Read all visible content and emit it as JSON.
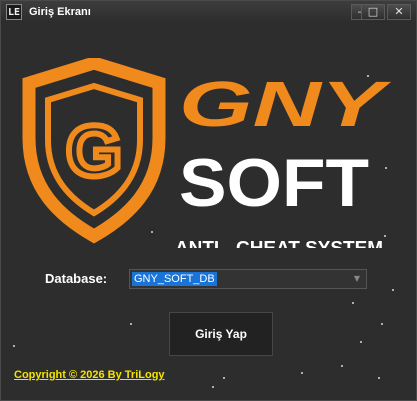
{
  "window": {
    "icon_text": "LE",
    "title": "Giriş Ekranı",
    "minimize_glyph": "—",
    "maximize_glyph": "□",
    "close_glyph": "✕"
  },
  "logo": {
    "letter": "G",
    "brand_top": "GNY",
    "brand_bottom": "SOFT",
    "tagline": "ANTI - CHEAT SYSTEM",
    "accent_color": "#f08a1c"
  },
  "form": {
    "database_label": "Database:",
    "database_value": "GNY_SOFT_DB",
    "login_label": "Giriş Yap"
  },
  "footer": {
    "copyright": "Copyright © 2026 By TriLogy"
  }
}
